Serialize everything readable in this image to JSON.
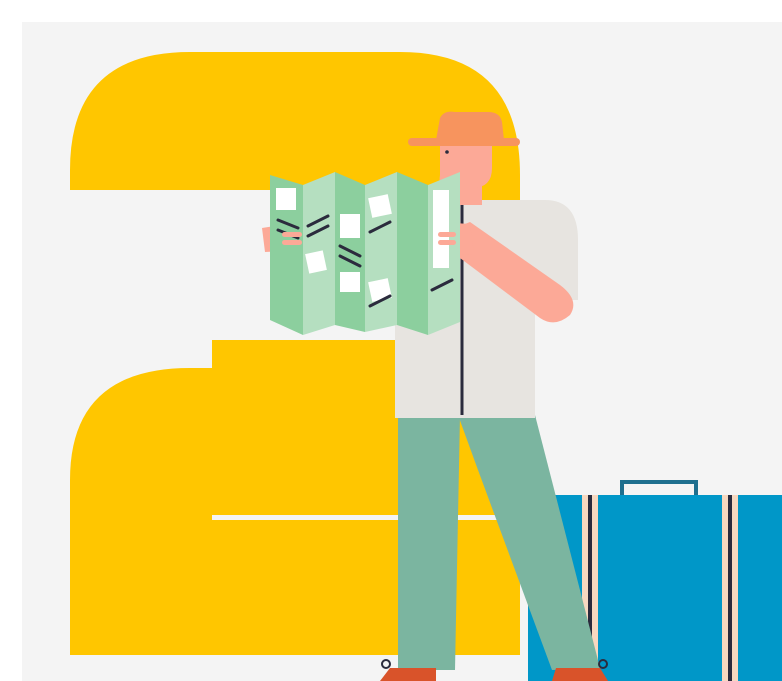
{
  "scene": {
    "digit": "2",
    "colors": {
      "background": "#F4F4F4",
      "digit": "#FFC600",
      "shirt": "#E7E4E0",
      "skin": "#FCA997",
      "hat": "#F7945E",
      "trousers": "#7BB5A0",
      "shoe": "#D9532A",
      "lace": "#2B2B3D",
      "map_dark": "#8CCF9E",
      "map_light": "#B5DFC0",
      "map_note": "#FFFFFF",
      "map_ink": "#2B2B3D",
      "suitcase": "#0097C8",
      "strap": "#F7D8C0",
      "handle": "#1F6F8E"
    },
    "elements": [
      "number-two-icon",
      "traveler",
      "folded-map-icon",
      "suitcase-icon"
    ]
  }
}
